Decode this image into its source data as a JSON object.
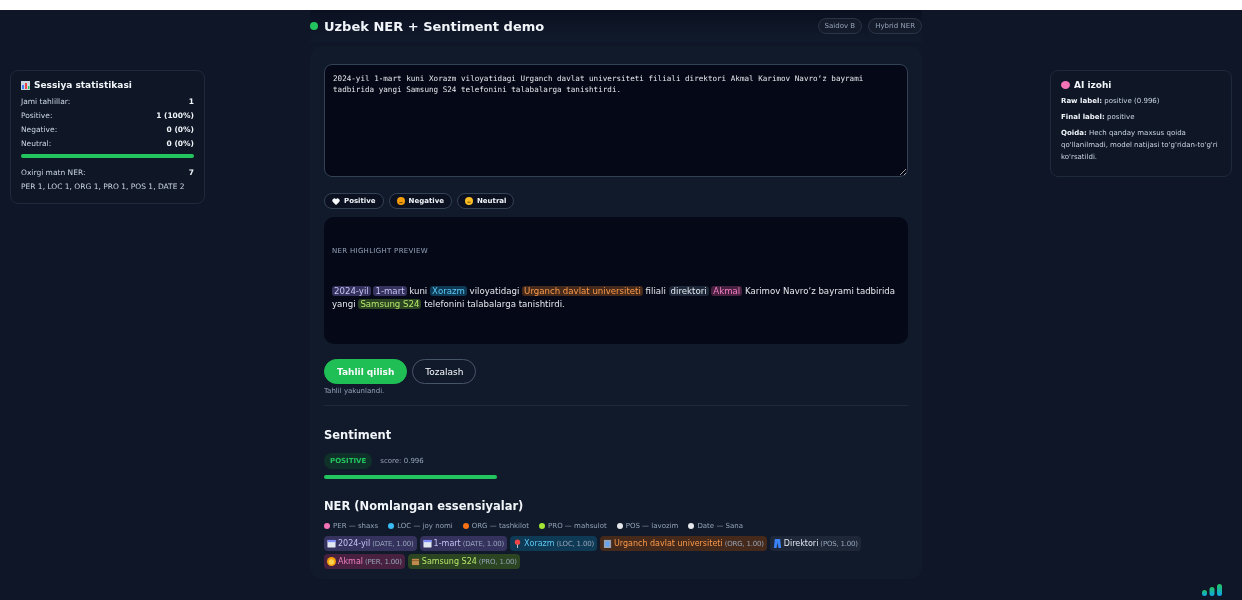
{
  "header": {
    "title": "Uzbek NER + Sentiment demo",
    "badges": [
      "Saidov B",
      "Hybrid NER"
    ]
  },
  "input": {
    "value": "2024-yil 1-mart kuni Xorazm viloyatidagi Urganch davlat universiteti filiali direktori Akmal Karimov Navro‘z bayrami tadbirida yangi Samsung S24 telefonini talabalarga tanishtirdi."
  },
  "sentiment_options": [
    {
      "label": "Positive",
      "kind": "positive"
    },
    {
      "label": "Negative",
      "kind": "negative"
    },
    {
      "label": "Neutral",
      "kind": "neutral"
    }
  ],
  "preview": {
    "label": "NER HIGHLIGHT PREVIEW",
    "segments": [
      {
        "text": "2024-yil",
        "kind": "date"
      },
      {
        "text": "1-mart",
        "kind": "date"
      },
      {
        "text": "kuni"
      },
      {
        "text": "Xorazm",
        "kind": "loc"
      },
      {
        "text": "viloyatidagi"
      },
      {
        "text": "Urganch davlat universiteti",
        "kind": "org"
      },
      {
        "text": "filiali"
      },
      {
        "text": "direktori",
        "kind": "pos"
      },
      {
        "text": "Akmal",
        "kind": "per"
      },
      {
        "text": "Karimov Navro‘z bayrami tadbirida yangi"
      },
      {
        "text": "Samsung S24",
        "kind": "pro"
      },
      {
        "text": "telefonini talabalarga tanishtirdi."
      }
    ]
  },
  "actions": [
    {
      "label": "Tahlil qilish",
      "kind": "primary"
    },
    {
      "label": "Tozalash",
      "kind": "secondary"
    }
  ],
  "status": "Tahlil yakunlandi.",
  "sentiment": {
    "title": "Sentiment",
    "badge": "POSITIVE",
    "score": "score: 0.996",
    "level": 0.996
  },
  "ner": {
    "title": "NER (Nomlangan essensiyalar)",
    "legend": [
      {
        "label": "PER — shaxs",
        "color": "#f472b6"
      },
      {
        "label": "LOC — joy nomi",
        "color": "#38bdf8"
      },
      {
        "label": "ORG — tashkilot",
        "color": "#f97316"
      },
      {
        "label": "PRO — mahsulot",
        "color": "#a3e635"
      },
      {
        "label": "POS — lavozim",
        "color": "#e5e7eb"
      },
      {
        "label": "Date — Sana",
        "color": "#e5e7ea"
      }
    ],
    "entities": [
      {
        "text": "2024-yil",
        "meta": "(DATE, 1.00)",
        "kind": "date"
      },
      {
        "text": "1-mart",
        "meta": "(DATE, 1.00)",
        "kind": "date"
      },
      {
        "text": "Xorazm",
        "meta": "(LOC, 1.00)",
        "kind": "loc"
      },
      {
        "text": "Urganch davlat universiteti",
        "meta": "(ORG, 1.00)",
        "kind": "org"
      },
      {
        "text": "Direktori",
        "meta": "(POS, 1.00)",
        "kind": "pos"
      },
      {
        "text": "Akmal",
        "meta": "(PER, 1.00)",
        "kind": "per"
      },
      {
        "text": "Samsung S24",
        "meta": "(PRO, 1.00)",
        "kind": "pro"
      }
    ]
  },
  "stats": {
    "title": "Sessiya statistikasi",
    "rows": [
      {
        "label": "Jami tahlillar:",
        "value": "1"
      },
      {
        "label": "Positive:",
        "value": "1 (100%)"
      },
      {
        "label": "Negative:",
        "value": "0 (0%)"
      },
      {
        "label": "Neutral:",
        "value": "0 (0%)"
      }
    ],
    "level": 1,
    "ner_label": "Oxirgi matn NER:",
    "ner_value": "7",
    "ner_summary": "PER 1, LOC 1, ORG 1, PRO 1, POS 1, DATE 2"
  },
  "ai": {
    "title": "AI izohi",
    "lines": [
      {
        "label": "Raw label:",
        "text": "positive (0.996)"
      },
      {
        "label": "Final label:",
        "text": "positive"
      },
      {
        "label": "Qoida:",
        "text": "Hech qanday maxsus qoida qo'llanilmadi, model natijasi to'g'ridan-to'g'ri ko'rsatildi."
      }
    ]
  }
}
